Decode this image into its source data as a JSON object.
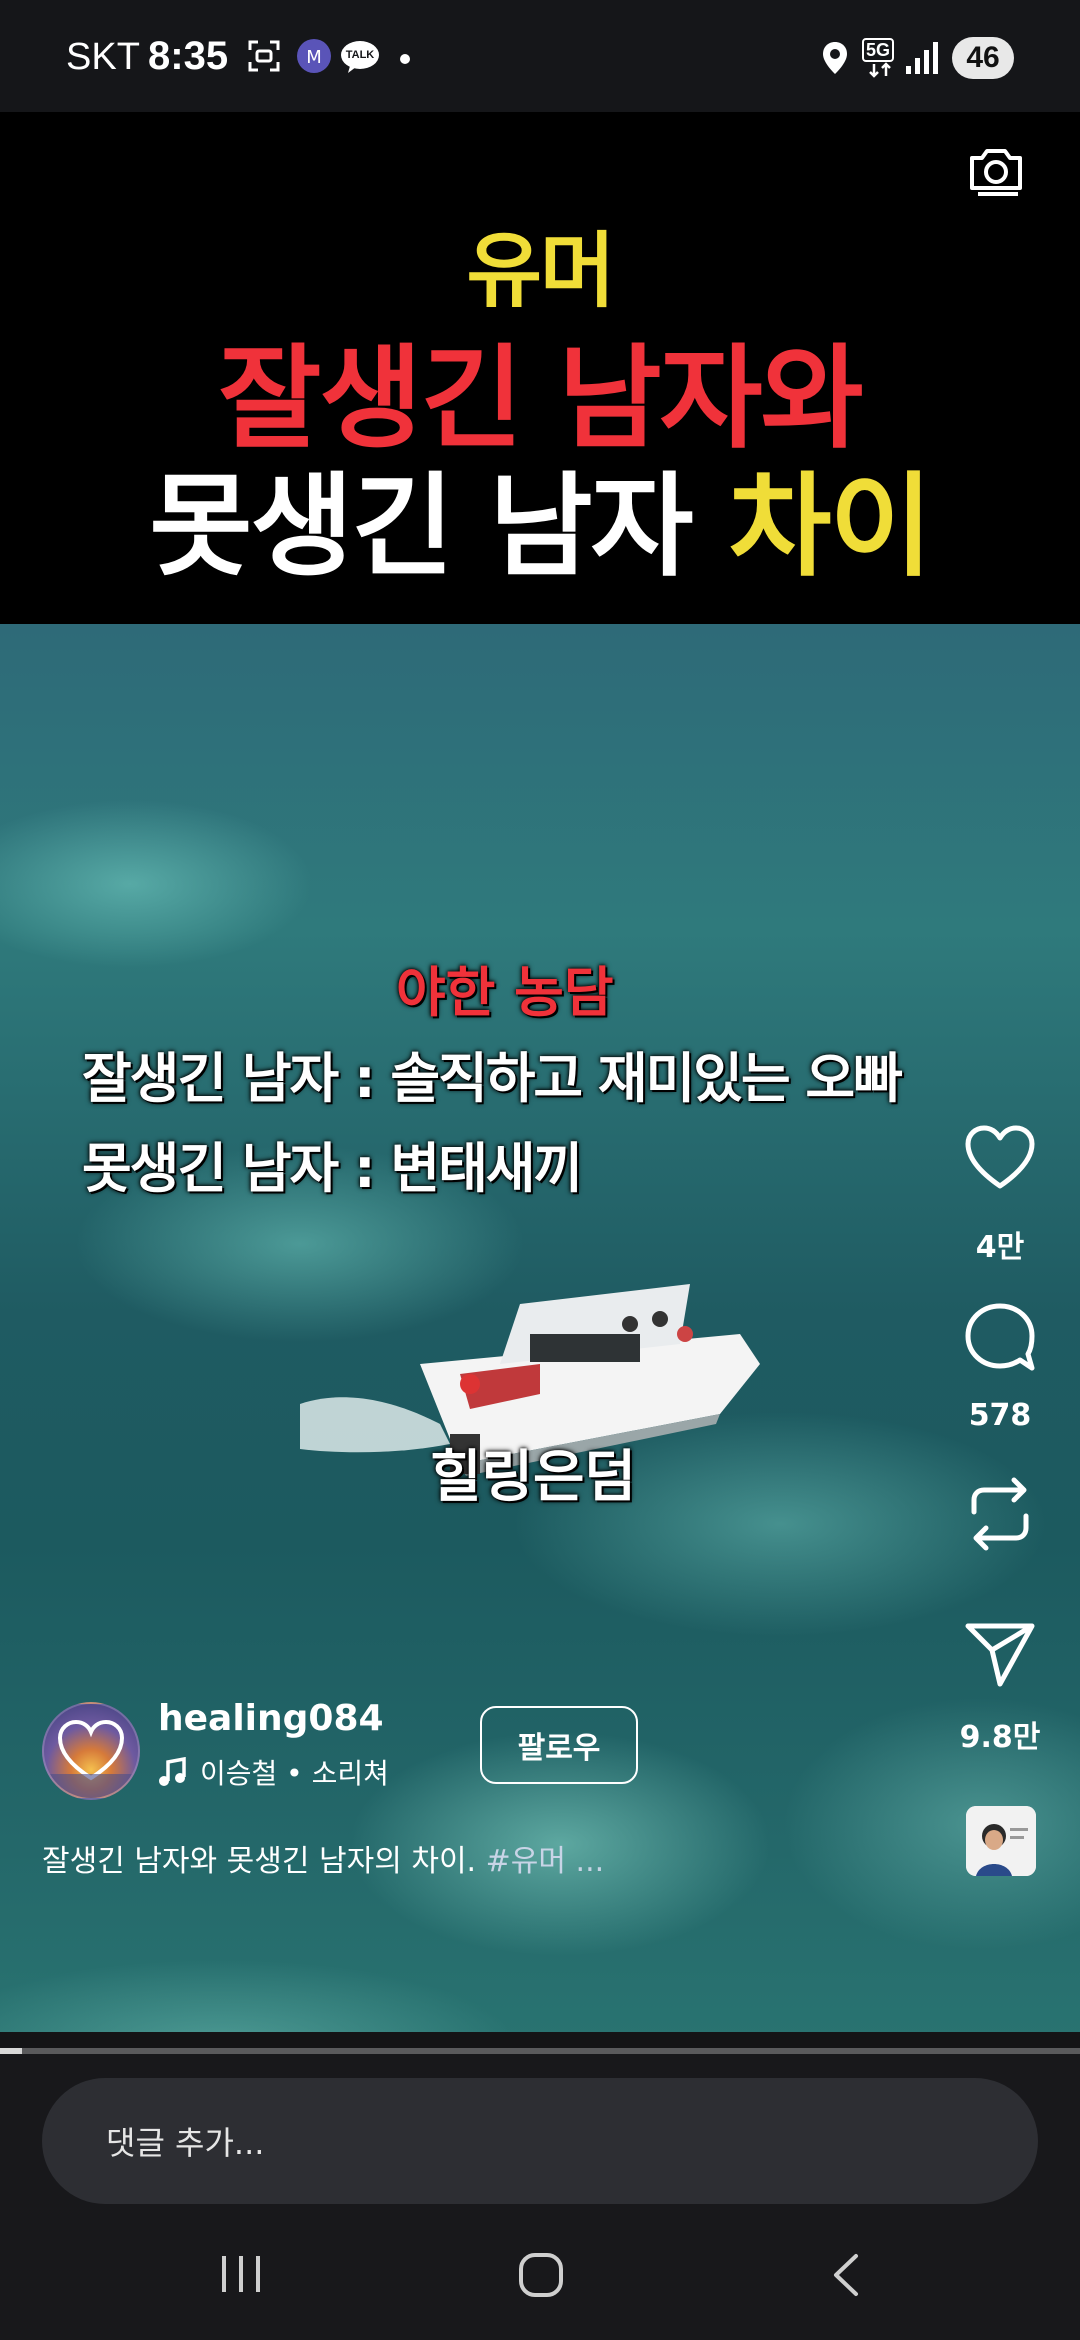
{
  "status_bar": {
    "carrier": "SKT",
    "time": "8:35",
    "messenger_badge": "TALK",
    "network": "5G",
    "battery": "46"
  },
  "video": {
    "title_line1": "유머",
    "title_line2": "잘생긴 남자와",
    "title_line3_white": "못생긴 남자",
    "title_line3_yellow": "차이",
    "overlay_heading": "야한 농담",
    "overlay_line1": "잘생긴 남자 : 솔직하고 재미있는 오빠",
    "overlay_line2": "못생긴 남자 : 변태새끼",
    "watermark": "힐링은덤",
    "progress_fraction": 0.02
  },
  "actions": {
    "likes": "4만",
    "comments": "578",
    "shares": "9.8만"
  },
  "author": {
    "username": "healing084",
    "music": "이승철 • 소리쳐",
    "follow_label": "팔로우"
  },
  "description": {
    "text": "잘생긴 남자와 못생긴 남자의 차이.",
    "hashtag": "#유머",
    "ellipsis": "..."
  },
  "comment": {
    "placeholder": "댓글 추가..."
  },
  "colors": {
    "title_yellow": "#f0dd38",
    "title_red": "#f0323a",
    "sea": "#2f7a7c"
  }
}
